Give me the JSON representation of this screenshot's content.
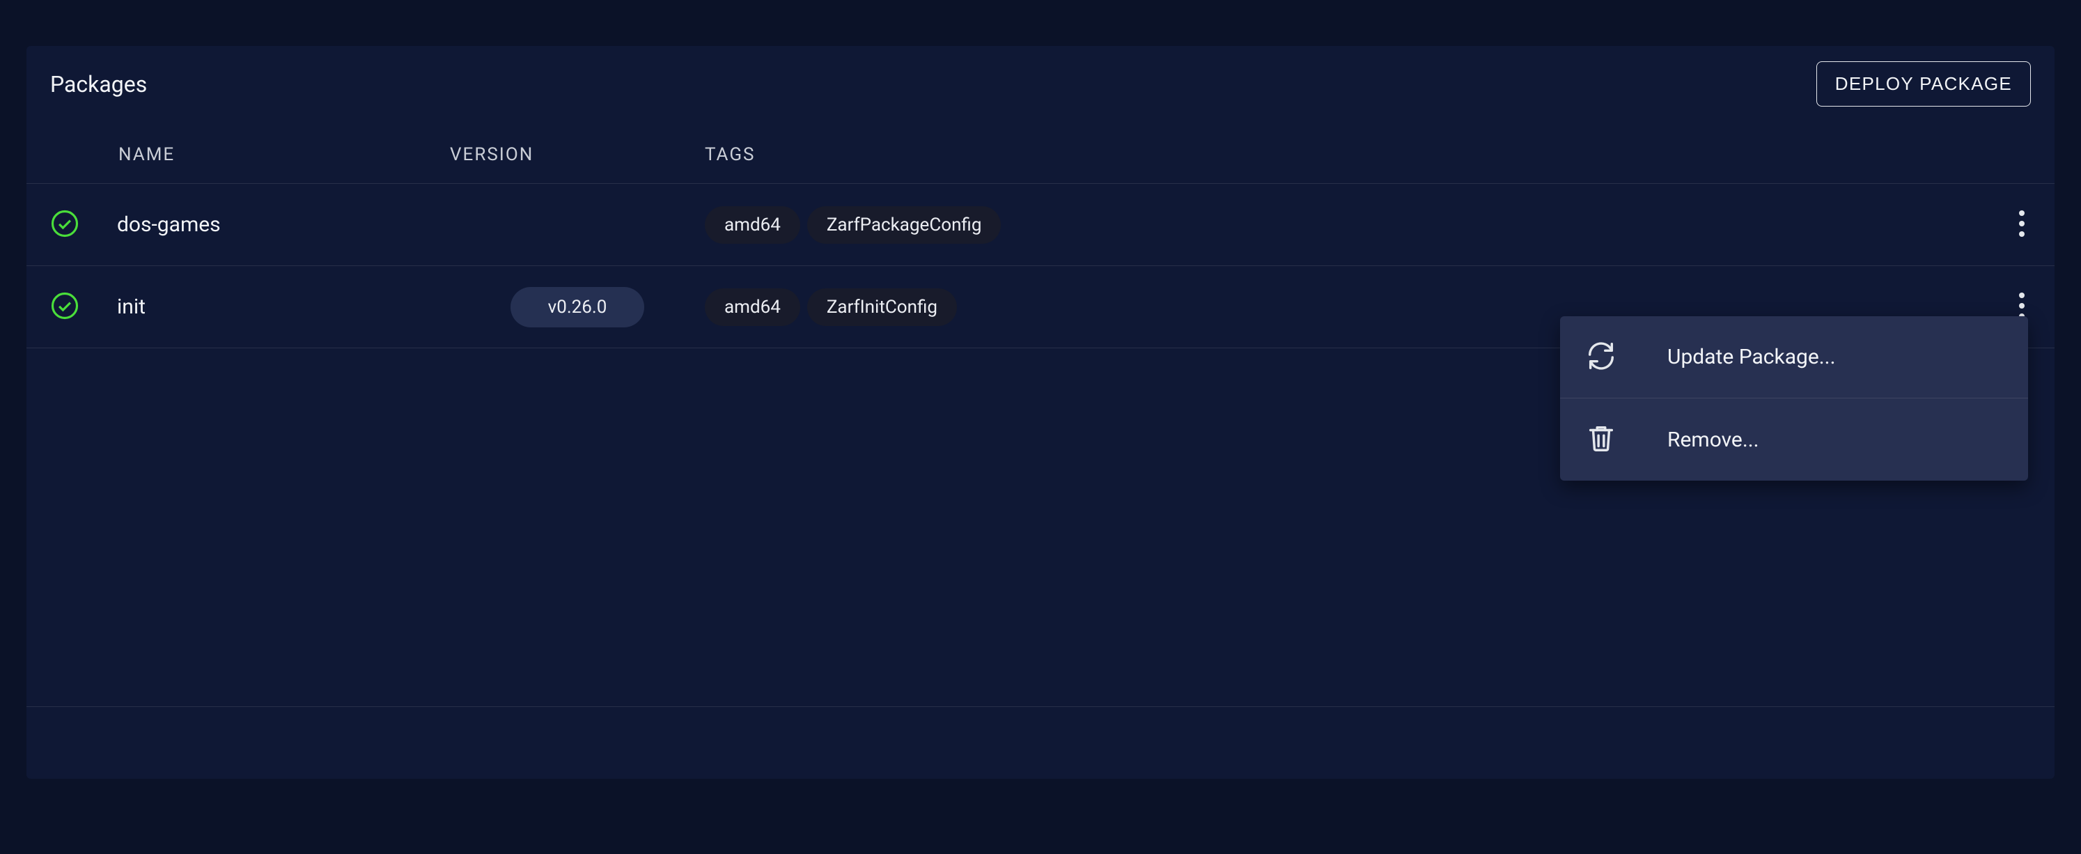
{
  "panel": {
    "title": "Packages",
    "deploy_button": "DEPLOY PACKAGE"
  },
  "columns": {
    "name": "NAME",
    "version": "VERSION",
    "tags": "TAGS"
  },
  "rows": [
    {
      "status": "ok",
      "name": "dos-games",
      "version": "",
      "tags": [
        "amd64",
        "ZarfPackageConfig"
      ]
    },
    {
      "status": "ok",
      "name": "init",
      "version": "v0.26.0",
      "tags": [
        "amd64",
        "ZarfInitConfig"
      ]
    }
  ],
  "context_menu": {
    "update_label": "Update Package...",
    "remove_label": "Remove..."
  },
  "icons": {
    "check_circle": "check-circle-icon",
    "kebab": "kebab-icon",
    "refresh": "refresh-icon",
    "trash": "trash-icon"
  }
}
